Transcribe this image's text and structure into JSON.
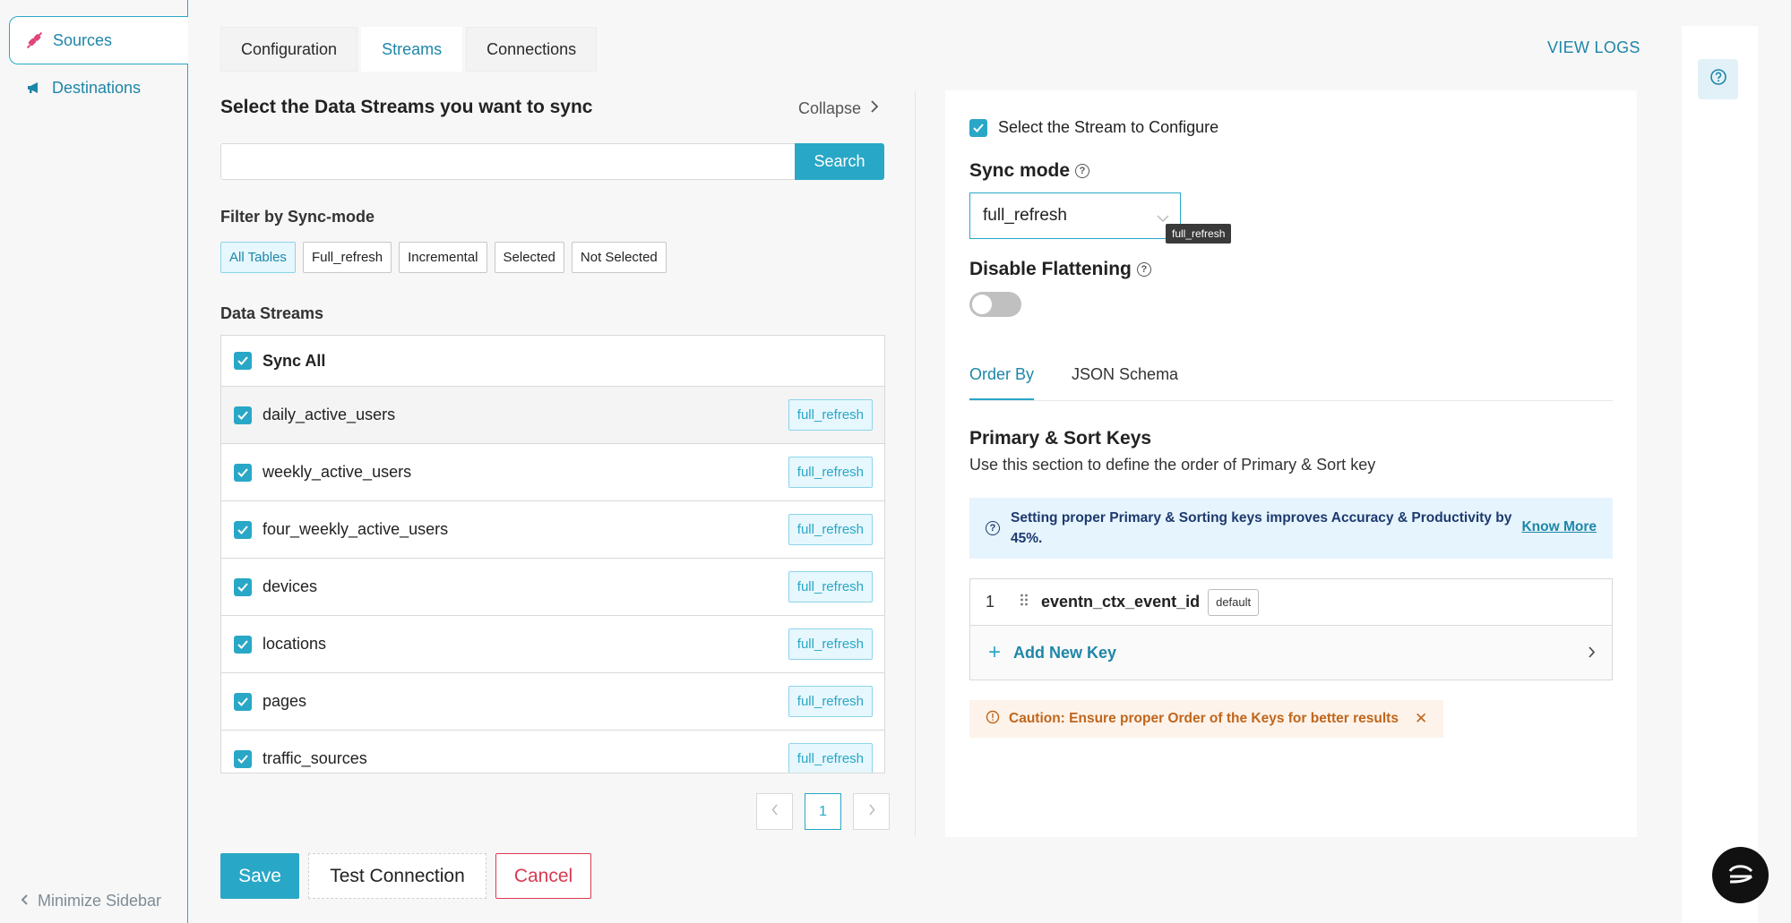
{
  "sidebar": {
    "items": [
      {
        "label": "Sources",
        "icon": "plug-icon"
      },
      {
        "label": "Destinations",
        "icon": "megaphone-icon"
      }
    ],
    "minimize_label": "Minimize Sidebar"
  },
  "tabs": [
    {
      "label": "Configuration"
    },
    {
      "label": "Streams"
    },
    {
      "label": "Connections"
    }
  ],
  "active_tab": "Streams",
  "view_logs_label": "VIEW LOGS",
  "streams_panel": {
    "title": "Select the Data Streams you want to sync",
    "collapse_label": "Collapse",
    "search": {
      "value": "",
      "placeholder": "",
      "button_label": "Search"
    },
    "filter_label": "Filter by Sync-mode",
    "filters": [
      "All Tables",
      "Full_refresh",
      "Incremental",
      "Selected",
      "Not Selected"
    ],
    "active_filter": "All Tables",
    "data_streams_label": "Data Streams",
    "sync_all_label": "Sync All",
    "streams": [
      {
        "name": "daily_active_users",
        "mode": "full_refresh",
        "checked": true
      },
      {
        "name": "weekly_active_users",
        "mode": "full_refresh",
        "checked": true
      },
      {
        "name": "four_weekly_active_users",
        "mode": "full_refresh",
        "checked": true
      },
      {
        "name": "devices",
        "mode": "full_refresh",
        "checked": true
      },
      {
        "name": "locations",
        "mode": "full_refresh",
        "checked": true
      },
      {
        "name": "pages",
        "mode": "full_refresh",
        "checked": true
      },
      {
        "name": "traffic_sources",
        "mode": "full_refresh",
        "checked": true
      }
    ],
    "pagination": {
      "current_page": "1"
    }
  },
  "config_panel": {
    "select_stream_label": "Select the Stream to Configure",
    "sync_mode_label": "Sync mode",
    "sync_mode_value": "full_refresh",
    "sync_mode_tooltip": "full_refresh",
    "disable_flattening_label": "Disable Flattening",
    "disable_flattening_on": false,
    "subtabs": [
      "Order By",
      "JSON Schema"
    ],
    "active_subtab": "Order By",
    "pk_title": "Primary & Sort Keys",
    "pk_description": "Use this section to define the order of Primary & Sort key",
    "info_text": "Setting proper Primary & Sorting keys improves Accuracy & Productivity by 45%.",
    "know_more_label": "Know More",
    "keys": [
      {
        "index": "1",
        "name": "eventn_ctx_event_id",
        "tag": "default"
      }
    ],
    "add_key_label": "Add New Key",
    "caution_text": "Caution: Ensure proper Order of the Keys for better results"
  },
  "footer": {
    "save_label": "Save",
    "test_label": "Test Connection",
    "cancel_label": "Cancel"
  },
  "colors": {
    "accent": "#29a7c7",
    "cancel": "#d83a52",
    "caution": "#c0661c"
  }
}
